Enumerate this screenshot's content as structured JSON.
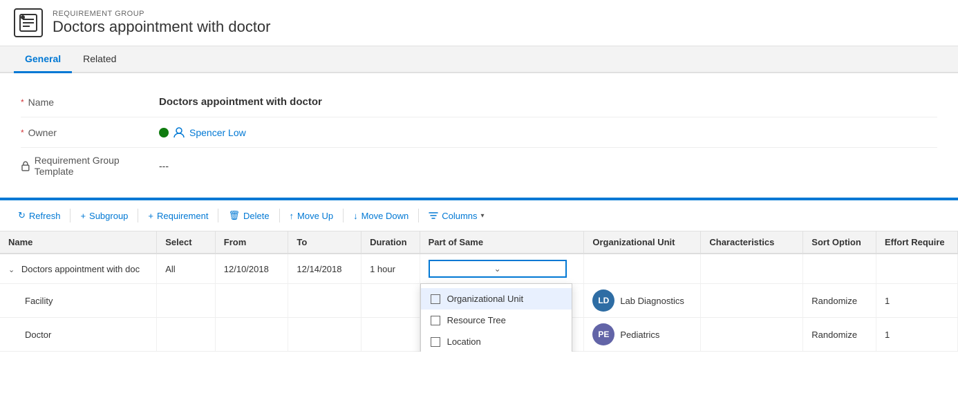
{
  "header": {
    "label": "REQUIREMENT GROUP",
    "title": "Doctors appointment with doctor",
    "icon": "📋"
  },
  "tabs": [
    {
      "id": "general",
      "label": "General",
      "active": true
    },
    {
      "id": "related",
      "label": "Related",
      "active": false
    }
  ],
  "form": {
    "fields": [
      {
        "id": "name",
        "label": "Name",
        "required": true,
        "value": "Doctors appointment with doctor",
        "type": "text-bold"
      },
      {
        "id": "owner",
        "label": "Owner",
        "required": true,
        "value": "Spencer Low",
        "type": "owner"
      },
      {
        "id": "template",
        "label": "Requirement Group Template",
        "required": false,
        "value": "---",
        "type": "text",
        "hasLock": true
      }
    ]
  },
  "toolbar": {
    "buttons": [
      {
        "id": "refresh",
        "label": "Refresh",
        "icon": "↻",
        "disabled": false
      },
      {
        "id": "subgroup",
        "label": "Subgroup",
        "icon": "+",
        "disabled": false
      },
      {
        "id": "requirement",
        "label": "Requirement",
        "icon": "+",
        "disabled": false
      },
      {
        "id": "delete",
        "label": "Delete",
        "icon": "🗑",
        "disabled": false
      },
      {
        "id": "move-up",
        "label": "Move Up",
        "icon": "↑",
        "disabled": false
      },
      {
        "id": "move-down",
        "label": "Move Down",
        "icon": "↓",
        "disabled": false
      },
      {
        "id": "columns",
        "label": "Columns",
        "icon": "▽",
        "disabled": false
      }
    ]
  },
  "table": {
    "columns": [
      {
        "id": "name",
        "label": "Name"
      },
      {
        "id": "select",
        "label": "Select"
      },
      {
        "id": "from",
        "label": "From"
      },
      {
        "id": "to",
        "label": "To"
      },
      {
        "id": "duration",
        "label": "Duration"
      },
      {
        "id": "part-of-same",
        "label": "Part of Same"
      },
      {
        "id": "org-unit",
        "label": "Organizational Unit"
      },
      {
        "id": "characteristics",
        "label": "Characteristics"
      },
      {
        "id": "sort-option",
        "label": "Sort Option"
      },
      {
        "id": "effort-required",
        "label": "Effort Require"
      }
    ],
    "rows": [
      {
        "id": "parent",
        "name": "Doctors appointment with doc",
        "expanded": true,
        "select": "All",
        "from": "12/10/2018",
        "to": "12/14/2018",
        "duration": "1 hour",
        "partOfSame": "",
        "orgUnit": "",
        "characteristics": "",
        "sortOption": "",
        "effortRequired": ""
      },
      {
        "id": "child1",
        "name": "Facility",
        "expanded": false,
        "select": "",
        "from": "",
        "to": "",
        "duration": "",
        "partOfSame": "",
        "orgUnit": "Lab Diagnostics",
        "orgUnitAvatar": "LD",
        "orgUnitAvatarClass": "avatar-ld",
        "characteristics": "",
        "sortOption": "Randomize",
        "effortRequired": "1"
      },
      {
        "id": "child2",
        "name": "Doctor",
        "expanded": false,
        "select": "",
        "from": "",
        "to": "",
        "duration": "",
        "partOfSame": "",
        "orgUnit": "Pediatrics",
        "orgUnitAvatar": "PE",
        "orgUnitAvatarClass": "avatar-pe",
        "characteristics": "",
        "sortOption": "Randomize",
        "effortRequired": "1"
      }
    ]
  },
  "dropdown": {
    "open": true,
    "options": [
      {
        "id": "org-unit",
        "label": "Organizational Unit",
        "checked": false,
        "highlighted": true
      },
      {
        "id": "resource-tree",
        "label": "Resource Tree",
        "checked": false
      },
      {
        "id": "location",
        "label": "Location",
        "checked": false
      }
    ]
  }
}
